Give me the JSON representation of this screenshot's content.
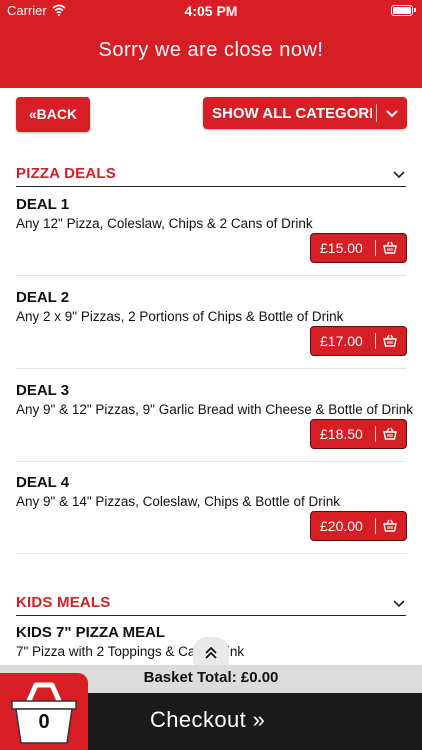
{
  "status_bar": {
    "carrier": "Carrier",
    "time": "4:05 PM"
  },
  "header": {
    "message": "Sorry we are close now!"
  },
  "toolbar": {
    "back_label": "BACK",
    "categories_label": "SHOW ALL CATEGORI..."
  },
  "sections": [
    {
      "title": "PIZZA DEALS",
      "items": [
        {
          "name": "DEAL 1",
          "description": "Any 12\" Pizza, Coleslaw, Chips & 2 Cans of Drink",
          "price": "£15.00"
        },
        {
          "name": "DEAL 2",
          "description": "Any 2 x 9\" Pizzas, 2 Portions of Chips & Bottle of Drink",
          "price": "£17.00"
        },
        {
          "name": "DEAL 3",
          "description": "Any 9\" & 12\" Pizzas, 9\" Garlic Bread with Cheese & Bottle of Drink",
          "price": "£18.50"
        },
        {
          "name": "DEAL 4",
          "description": "Any 9\" & 14\" Pizzas, Coleslaw, Chips & Bottle of Drink",
          "price": "£20.00"
        }
      ]
    },
    {
      "title": "KIDS MEALS",
      "items": [
        {
          "name": "KIDS 7\" PIZZA MEAL",
          "description": "7\" Pizza with 2 Toppings & Car",
          "description_tail": "ink"
        }
      ]
    }
  ],
  "footer": {
    "basket_total": "Basket Total: £0.00",
    "checkout_label": "Checkout »",
    "basket_count": "0"
  },
  "colors": {
    "brand_red": "#d81e25",
    "footer_dark": "#1a1a1a",
    "total_bar": "#dcdcdc"
  },
  "icons": [
    "wifi-icon",
    "battery-icon",
    "back-chevrons-icon",
    "chevron-down-icon",
    "basket-icon",
    "scroll-up-icon"
  ]
}
